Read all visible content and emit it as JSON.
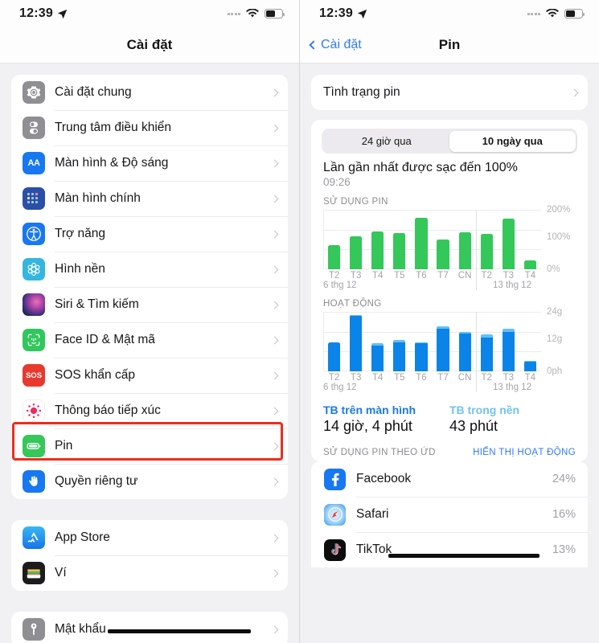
{
  "status_bar": {
    "time": "12:39",
    "location_icon": "location-arrow-icon",
    "wifi_icon": "wifi-icon",
    "battery_icon": "battery-icon"
  },
  "left_screen": {
    "nav_title": "Cài đặt",
    "groups": [
      {
        "items": [
          {
            "label": "Cài đặt chung",
            "icon": "gear-icon",
            "icon_bg": "#8e8e93"
          },
          {
            "label": "Trung tâm điều khiển",
            "icon": "control-center-icon",
            "icon_bg": "#8e8e93"
          },
          {
            "label": "Màn hình & Độ sáng",
            "icon": "display-brightness-icon",
            "icon_bg": "#1878f0"
          },
          {
            "label": "Màn hình chính",
            "icon": "home-screen-icon",
            "icon_bg": "#2b4fa8"
          },
          {
            "label": "Trợ năng",
            "icon": "accessibility-icon",
            "icon_bg": "#1878f0"
          },
          {
            "label": "Hình nền",
            "icon": "wallpaper-icon",
            "icon_bg": "#35b6e0"
          },
          {
            "label": "Siri & Tìm kiếm",
            "icon": "siri-icon",
            "icon_bg": "#1a1a2e"
          },
          {
            "label": "Face ID & Mật mã",
            "icon": "faceid-icon",
            "icon_bg": "#30c85c"
          },
          {
            "label": "SOS khẩn cấp",
            "icon": "sos-icon",
            "icon_bg": "#e8392f"
          },
          {
            "label": "Thông báo tiếp xúc",
            "icon": "exposure-notification-icon",
            "icon_bg": "#ffffff"
          },
          {
            "label": "Pin",
            "icon": "battery-green-icon",
            "icon_bg": "#35c759",
            "highlighted": true
          },
          {
            "label": "Quyền riêng tư",
            "icon": "privacy-hand-icon",
            "icon_bg": "#1878f0"
          }
        ]
      },
      {
        "items": [
          {
            "label": "App Store",
            "icon": "app-store-icon",
            "icon_bg": "#1a9bf0"
          },
          {
            "label": "Ví",
            "icon": "wallet-icon",
            "icon_bg": "#1c1c1e"
          }
        ]
      },
      {
        "items": [
          {
            "label": "Mật khẩu",
            "icon": "password-key-icon",
            "icon_bg": "#8e8e93",
            "redacted": true
          }
        ]
      }
    ]
  },
  "right_screen": {
    "nav_back_label": "Cài đặt",
    "nav_title": "Pin",
    "battery_health_row": {
      "label": "Tình trạng pin",
      "icon": "chevron-right-icon"
    },
    "segmented": {
      "options": [
        "24 giờ qua",
        "10 ngày qua"
      ],
      "selected_index": 1
    },
    "last_charge": {
      "title": "Lần gần nhất được sạc đến 100%",
      "time": "09:26"
    },
    "battery_section_title": "SỬ DỤNG PIN",
    "activity_section_title": "HOẠT ĐỘNG",
    "stats": [
      {
        "label": "TB trên màn hình",
        "value": "14 giờ, 4 phút",
        "color": "#1a7ae0"
      },
      {
        "label": "TB trong nền",
        "value": "43 phút",
        "color": "#72c2ef"
      }
    ],
    "app_usage_header": {
      "left": "SỬ DỤNG PIN THEO ỨD",
      "right": "HIỂN THỊ HOẠT ĐỘNG"
    },
    "apps": [
      {
        "name": "Facebook",
        "percent": "24%",
        "icon": "facebook-icon",
        "icon_bg": "#1877f2"
      },
      {
        "name": "Safari",
        "percent": "16%",
        "icon": "safari-icon",
        "icon_bg": "#3ba4f0"
      },
      {
        "name": "TikTok",
        "percent": "13%",
        "icon": "tiktok-icon",
        "icon_bg": "#0d0d0d",
        "redacted": true
      }
    ]
  },
  "chart_data": [
    {
      "type": "bar",
      "title": "SỬ DỤNG PIN",
      "xlabel": "",
      "ylabel": "",
      "categories": [
        "T2",
        "T3",
        "T4",
        "T5",
        "T6",
        "T7",
        "CN",
        "T2",
        "T3",
        "T4"
      ],
      "values": [
        88,
        118,
        138,
        132,
        186,
        108,
        134,
        128,
        182,
        32
      ],
      "ytick_labels": [
        "200%",
        "100%",
        "0%"
      ],
      "ytick_values": [
        200,
        100,
        0
      ],
      "ylim": [
        0,
        215
      ],
      "date_labels": [
        "6 thg 12",
        "13 thg 12"
      ],
      "bar_color": "#34c759",
      "grid": true,
      "legend": "none"
    },
    {
      "type": "bar",
      "title": "HOẠT ĐỘNG",
      "xlabel": "",
      "ylabel": "",
      "categories": [
        "T2",
        "T3",
        "T4",
        "T5",
        "T6",
        "T7",
        "CN",
        "T2",
        "T3",
        "T4"
      ],
      "series": [
        {
          "name": "TB trên màn hình",
          "color": "#0a84e8",
          "values": [
            12.0,
            23.3,
            10.8,
            12.3,
            12.1,
            17.8,
            16.0,
            14.2,
            16.6,
            4.0
          ]
        },
        {
          "name": "TB trong nền",
          "color": "#62c0f5",
          "values": [
            0.0,
            0.4,
            1.0,
            0.9,
            0.2,
            1.2,
            0.5,
            1.2,
            1.2,
            0.4
          ]
        }
      ],
      "ytick_labels": [
        "24g",
        "12g",
        "0ph"
      ],
      "ytick_values": [
        24,
        12,
        0
      ],
      "ylim": [
        0,
        25
      ],
      "date_labels": [
        "6 thg 12",
        "13 thg 12"
      ],
      "stacked": true,
      "grid": true,
      "legend": "none"
    }
  ]
}
